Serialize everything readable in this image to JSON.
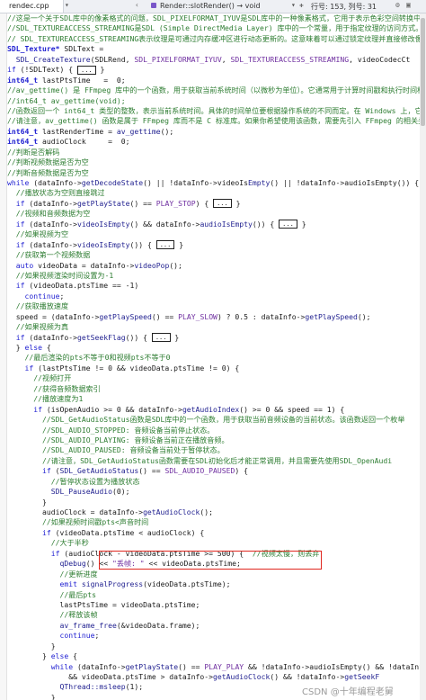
{
  "editor": {
    "tab_filename": "rendec.cpp",
    "function_scope": "Render::slotRender() → void",
    "status": "行号: 153, 列号: 31",
    "watermark": "CSDN @十年编程老舅"
  },
  "code_lines": [
    {
      "i": 0,
      "parts": [
        [
          "cm",
          "//这是一个关于SDL库中的像素格式的问题，SDL_PIXELFORMAT_IYUV是SDL库中的一种像素格式，它用于表示色彩空间转换中的Y"
        ]
      ]
    },
    {
      "i": 0,
      "parts": [
        [
          "cm",
          "//SDL_TEXTUREACCESS_STREAMING是SDL (Simple DirectMedia Layer) 库中的一个常量，用于指定纹理的访问方式。"
        ]
      ]
    },
    {
      "i": 0,
      "parts": [
        [
          "cm",
          "// SDL_TEXTUREACCESS_STREAMING表示纹理是可通过内存缓冲区进行动态更新的。这意味着可以通过锁定纹理并直接修改像"
        ]
      ]
    },
    {
      "i": 0,
      "parts": [
        [
          "ty",
          "SDL_Texture*"
        ],
        [
          "vr",
          " SDLText ="
        ]
      ]
    },
    {
      "i": 2,
      "parts": [
        [
          "fn",
          "SDL_CreateTexture"
        ],
        [
          "vr",
          "(SDLRend, "
        ],
        [
          "mc",
          "SDL_PIXELFORMAT_IYUV"
        ],
        [
          "vr",
          ", "
        ],
        [
          "mc",
          "SDL_TEXTUREACCESS_STREAMING"
        ],
        [
          "vr",
          ", videoCodecCt"
        ]
      ]
    },
    {
      "i": 0,
      "parts": [
        [
          "kw",
          "if"
        ],
        [
          "vr",
          " (!SDLText) { "
        ],
        [
          "fold",
          "..."
        ],
        [
          "vr",
          " }"
        ]
      ]
    },
    {
      "i": 0,
      "parts": [
        [
          "ty",
          "int64_t"
        ],
        [
          "vr",
          " lastPtsTime   =  0;"
        ]
      ]
    },
    {
      "i": 0,
      "parts": [
        [
          "cm",
          "//av_gettime() 是 FFmpeg 库中的一个函数，用于获取当前系统时间（以微秒为单位）。它通常用于计算时间戳和执行时间相"
        ]
      ]
    },
    {
      "i": 0,
      "parts": [
        [
          "cm",
          "//int64_t av_gettime(void);"
        ]
      ]
    },
    {
      "i": 0,
      "parts": [
        [
          "cm",
          "//函数返回一个 int64_t 类型的整数，表示当前系统时间。具体的时间单位要根据操作系统的不同而定。在 Windows 上，它通"
        ]
      ]
    },
    {
      "i": 0,
      "parts": [
        [
          "cm",
          "//请注意，av_gettime() 函数是属于 FFmpeg 库而不是 C 标准库。如果你希望使用该函数，需要先引入 FFmpeg 的相关头文件"
        ]
      ]
    },
    {
      "i": 0,
      "parts": [
        [
          "ty",
          "int64_t"
        ],
        [
          "vr",
          " lastRenderTime = "
        ],
        [
          "fn",
          "av_gettime"
        ],
        [
          "vr",
          "();"
        ]
      ]
    },
    {
      "i": 0,
      "parts": [
        [
          "ty",
          "int64_t"
        ],
        [
          "vr",
          " audioClock     =  0;"
        ]
      ]
    },
    {
      "i": 0,
      "parts": [
        [
          "cm",
          "//判断是否解码"
        ]
      ]
    },
    {
      "i": 0,
      "parts": [
        [
          "cm",
          "//判断视频数据是否为空"
        ]
      ]
    },
    {
      "i": 0,
      "parts": [
        [
          "cm",
          "//判断音频数据是否为空"
        ]
      ]
    },
    {
      "i": 0,
      "parts": [
        [
          "kw",
          "while"
        ],
        [
          "vr",
          " (dataInfo->"
        ],
        [
          "fn",
          "getDecodeState"
        ],
        [
          "vr",
          "() || !dataInfo->videoIs"
        ],
        [
          "fn",
          "Empty"
        ],
        [
          "vr",
          "() || !dataInfo->audioIsEmpty()) {"
        ]
      ]
    },
    {
      "i": 2,
      "parts": [
        [
          "cm",
          "//播放状态为空则直接跳过"
        ]
      ]
    },
    {
      "i": 2,
      "parts": [
        [
          "kw",
          "if"
        ],
        [
          "vr",
          " (dataInfo->"
        ],
        [
          "fn",
          "getPlayState"
        ],
        [
          "vr",
          "() == "
        ],
        [
          "mc",
          "PLAY_STOP"
        ],
        [
          "vr",
          ") { "
        ],
        [
          "fold",
          "..."
        ],
        [
          "vr",
          " }"
        ]
      ]
    },
    {
      "i": 2,
      "parts": [
        [
          "cm",
          "//视频和音频数据为空"
        ]
      ]
    },
    {
      "i": 2,
      "parts": [
        [
          "kw",
          "if"
        ],
        [
          "vr",
          " (dataInfo->"
        ],
        [
          "fn",
          "videoIsEmpty"
        ],
        [
          "vr",
          "() && dataInfo->"
        ],
        [
          "fn",
          "audioIsEmpty"
        ],
        [
          "vr",
          "()) { "
        ],
        [
          "fold",
          "..."
        ],
        [
          "vr",
          " }"
        ]
      ]
    },
    {
      "i": 2,
      "parts": [
        [
          "cm",
          "//如果视频为空"
        ]
      ]
    },
    {
      "i": 2,
      "parts": [
        [
          "kw",
          "if"
        ],
        [
          "vr",
          " (dataInfo->"
        ],
        [
          "fn",
          "videoIsEmpty"
        ],
        [
          "vr",
          "()) { "
        ],
        [
          "fold",
          "..."
        ],
        [
          "vr",
          " }"
        ]
      ]
    },
    {
      "i": 2,
      "parts": [
        [
          "cm",
          "//获取第一个视频数据"
        ]
      ]
    },
    {
      "i": 2,
      "parts": [
        [
          "kw",
          "auto"
        ],
        [
          "vr",
          " videoData = dataInfo->"
        ],
        [
          "fn",
          "videoPop"
        ],
        [
          "vr",
          "();"
        ]
      ]
    },
    {
      "i": 2,
      "parts": [
        [
          "cm",
          "//如果视频渲染时间设置为-1"
        ]
      ]
    },
    {
      "i": 2,
      "parts": [
        [
          "kw",
          "if"
        ],
        [
          "vr",
          " (videoData.ptsTime == -1)"
        ]
      ]
    },
    {
      "i": 4,
      "parts": [
        [
          "kw",
          "continue"
        ],
        [
          "vr",
          ";"
        ]
      ]
    },
    {
      "i": 2,
      "parts": [
        [
          "cm",
          "//获取播放速度"
        ]
      ]
    },
    {
      "i": 2,
      "parts": [
        [
          "vr",
          "speed = (dataInfo->"
        ],
        [
          "fn",
          "getPlaySpeed"
        ],
        [
          "vr",
          "() == "
        ],
        [
          "mc",
          "PLAY_SLOW"
        ],
        [
          "vr",
          ") ? 0.5 : dataInfo->"
        ],
        [
          "fn",
          "getPlaySpeed"
        ],
        [
          "vr",
          "();"
        ]
      ]
    },
    {
      "i": 2,
      "parts": [
        [
          "cm",
          "//如果视频为真"
        ]
      ]
    },
    {
      "i": 2,
      "parts": [
        [
          "kw",
          "if"
        ],
        [
          "vr",
          " (dataInfo->"
        ],
        [
          "fn",
          "getSeekFlag"
        ],
        [
          "vr",
          "()) { "
        ],
        [
          "fold",
          "..."
        ],
        [
          "vr",
          " }"
        ]
      ]
    },
    {
      "i": 2,
      "parts": [
        [
          "vr",
          "} "
        ],
        [
          "kw",
          "else"
        ],
        [
          "vr",
          " {"
        ]
      ]
    },
    {
      "i": 4,
      "parts": [
        [
          "cm",
          "//最后渲染的pts不等于0和视频pts不等于0"
        ]
      ]
    },
    {
      "i": 4,
      "parts": [
        [
          "kw",
          "if"
        ],
        [
          "vr",
          " (lastPtsTime != 0 && videoData.ptsTime != 0) {"
        ]
      ]
    },
    {
      "i": 6,
      "parts": [
        [
          "cm",
          "//视频打开"
        ]
      ]
    },
    {
      "i": 6,
      "parts": [
        [
          "cm",
          "//获得音频数据索引"
        ]
      ]
    },
    {
      "i": 6,
      "parts": [
        [
          "cm",
          "//播放速度为1"
        ]
      ]
    },
    {
      "i": 6,
      "parts": [
        [
          "kw",
          "if"
        ],
        [
          "vr",
          " (isOpenAudio >= 0 && dataInfo->"
        ],
        [
          "fn",
          "getAudioIndex"
        ],
        [
          "vr",
          "() >= 0 && speed == 1) {"
        ]
      ]
    },
    {
      "i": 8,
      "parts": [
        [
          "cm",
          "//SDL_GetAudioStatus函数是SDL库中的一个函数，用于获取当前音频设备的当前状态。该函数返回一个枚举"
        ]
      ]
    },
    {
      "i": 8,
      "parts": [
        [
          "cm",
          "//SDL_AUDIO_STOPPED: 音频设备当前停止状态。"
        ]
      ]
    },
    {
      "i": 8,
      "parts": [
        [
          "cm",
          "//SDL_AUDIO_PLAYING: 音频设备当前正在播放音频。"
        ]
      ]
    },
    {
      "i": 8,
      "parts": [
        [
          "cm",
          "//SDL_AUDIO_PAUSED: 音频设备当前处于暂停状态。"
        ]
      ]
    },
    {
      "i": 8,
      "parts": [
        [
          "cm",
          "//请注意，SDL_GetAudioStatus函数需要在SDL初始化后才能正常调用，并且需要先使用SDL_OpenAudi"
        ]
      ]
    },
    {
      "i": 8,
      "parts": [
        [
          "kw",
          "if"
        ],
        [
          "vr",
          " ("
        ],
        [
          "fn",
          "SDL_GetAudioStatus"
        ],
        [
          "vr",
          "() == "
        ],
        [
          "mc",
          "SDL_AUDIO_PAUSED"
        ],
        [
          "vr",
          ") {"
        ]
      ]
    },
    {
      "i": 10,
      "parts": [
        [
          "cm",
          "//暂停状态设置为播放状态"
        ]
      ]
    },
    {
      "i": 10,
      "parts": [
        [
          "fn",
          "SDL_PauseAudio"
        ],
        [
          "vr",
          "(0);"
        ]
      ]
    },
    {
      "i": 8,
      "parts": [
        [
          "vr",
          "}"
        ]
      ]
    },
    {
      "i": 8,
      "parts": [
        [
          "vr",
          "audioClock = dataInfo->"
        ],
        [
          "fn",
          "getAudioClock"
        ],
        [
          "vr",
          "();"
        ]
      ]
    },
    {
      "i": 8,
      "parts": [
        [
          "cm",
          "//如果视频时间戳pts<声音时间"
        ]
      ]
    },
    {
      "i": 8,
      "parts": [
        [
          "kw",
          "if"
        ],
        [
          "vr",
          " (videoData.ptsTime < audioClock) {"
        ]
      ]
    },
    {
      "i": 10,
      "parts": [
        [
          "cm",
          "//大于半秒"
        ]
      ]
    },
    {
      "i": 10,
      "parts": [
        [
          "kw",
          "if"
        ],
        [
          "vr",
          " (audioClock - videoData.ptsTime >= 500) {  "
        ],
        [
          "cm",
          "//视频太慢，则丢弃"
        ]
      ]
    },
    {
      "i": 12,
      "parts": [
        [
          "fn",
          "qDebug"
        ],
        [
          "vr",
          "() << "
        ],
        [
          "mc",
          "\"丢帧: \""
        ],
        [
          "vr",
          " << videoData.ptsTime;"
        ]
      ]
    },
    {
      "i": 12,
      "parts": [
        [
          "cm",
          "//更新进度"
        ]
      ]
    },
    {
      "i": 12,
      "parts": [
        [
          "kw",
          "emit"
        ],
        [
          "vr",
          " "
        ],
        [
          "fn",
          "signalProgress"
        ],
        [
          "vr",
          "(videoData.ptsTime);"
        ]
      ]
    },
    {
      "i": 12,
      "parts": [
        [
          "cm",
          "//最后pts"
        ]
      ]
    },
    {
      "i": 12,
      "parts": [
        [
          "vr",
          "lastPtsTime = videoData.ptsTime;"
        ]
      ]
    },
    {
      "i": 12,
      "parts": [
        [
          "cm",
          "//释放该帧"
        ]
      ]
    },
    {
      "i": 12,
      "parts": [
        [
          "fn",
          "av_frame_free"
        ],
        [
          "vr",
          "(&videoData.frame);"
        ]
      ]
    },
    {
      "i": 12,
      "parts": [
        [
          "kw",
          "continue"
        ],
        [
          "vr",
          ";"
        ]
      ]
    },
    {
      "i": 10,
      "parts": [
        [
          "vr",
          "}"
        ]
      ]
    },
    {
      "i": 8,
      "parts": [
        [
          "vr",
          "} "
        ],
        [
          "kw",
          "else"
        ],
        [
          "vr",
          " {"
        ]
      ]
    },
    {
      "i": 10,
      "parts": [
        [
          "kw",
          "while"
        ],
        [
          "vr",
          " (dataInfo->"
        ],
        [
          "fn",
          "getPlayState"
        ],
        [
          "vr",
          "() == "
        ],
        [
          "mc",
          "PLAY_PLAY"
        ],
        [
          "vr",
          " && !dataInfo->audioIsEmpty() && !dataInfo->"
        ]
      ]
    },
    {
      "i": 14,
      "parts": [
        [
          "vr",
          "&& videoData.ptsTime > dataInfo->"
        ],
        [
          "fn",
          "getAudioClock"
        ],
        [
          "vr",
          "() && !dataInfo->"
        ],
        [
          "fn",
          "getSeekF"
        ]
      ]
    },
    {
      "i": 12,
      "parts": [
        [
          "fn",
          "QThread::msleep"
        ],
        [
          "vr",
          "(1);"
        ]
      ]
    },
    {
      "i": 10,
      "parts": [
        [
          "vr",
          "}"
        ]
      ]
    },
    {
      "i": 8,
      "parts": [
        [
          "vr",
          "}"
        ]
      ]
    },
    {
      "i": 6,
      "parts": [
        [
          "vr",
          "} "
        ],
        [
          "kw",
          "else"
        ],
        [
          "vr",
          " {"
        ]
      ]
    },
    {
      "i": 8,
      "parts": [
        [
          "cm",
          "//音频数据大于0"
        ]
      ]
    }
  ]
}
